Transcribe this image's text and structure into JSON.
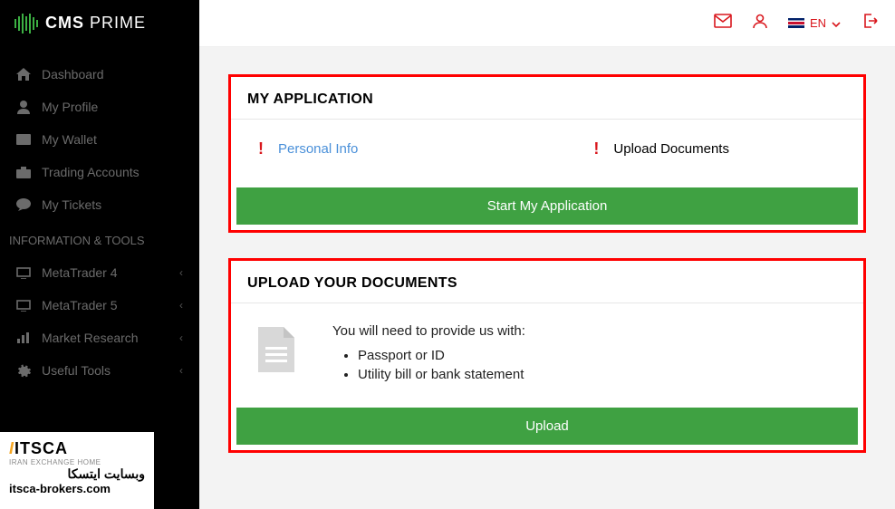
{
  "brand": {
    "cms": "CMS",
    "prime": "PRIME"
  },
  "header": {
    "lang": "EN"
  },
  "sidebar": {
    "items": [
      {
        "label": "Dashboard"
      },
      {
        "label": "My Profile"
      },
      {
        "label": "My Wallet"
      },
      {
        "label": "Trading Accounts"
      },
      {
        "label": "My Tickets"
      }
    ],
    "section": "INFORMATION & TOOLS",
    "tools": [
      {
        "label": "MetaTrader 4"
      },
      {
        "label": "MetaTrader 5"
      },
      {
        "label": "Market Research"
      },
      {
        "label": "Useful Tools"
      }
    ]
  },
  "badge": {
    "title_main": "ITSCA",
    "subtitle": "IRAN EXCHANGE HOME",
    "arabic": "وبسایت ایتسکا",
    "url": "itsca-brokers.com"
  },
  "app_panel": {
    "title": "MY APPLICATION",
    "personal": "Personal Info",
    "upload": "Upload Documents",
    "start_btn": "Start My Application"
  },
  "upload_panel": {
    "title": "UPLOAD YOUR DOCUMENTS",
    "intro": "You will need to provide us with:",
    "req1": "Passport or ID",
    "req2": "Utility bill or bank statement",
    "btn": "Upload"
  }
}
